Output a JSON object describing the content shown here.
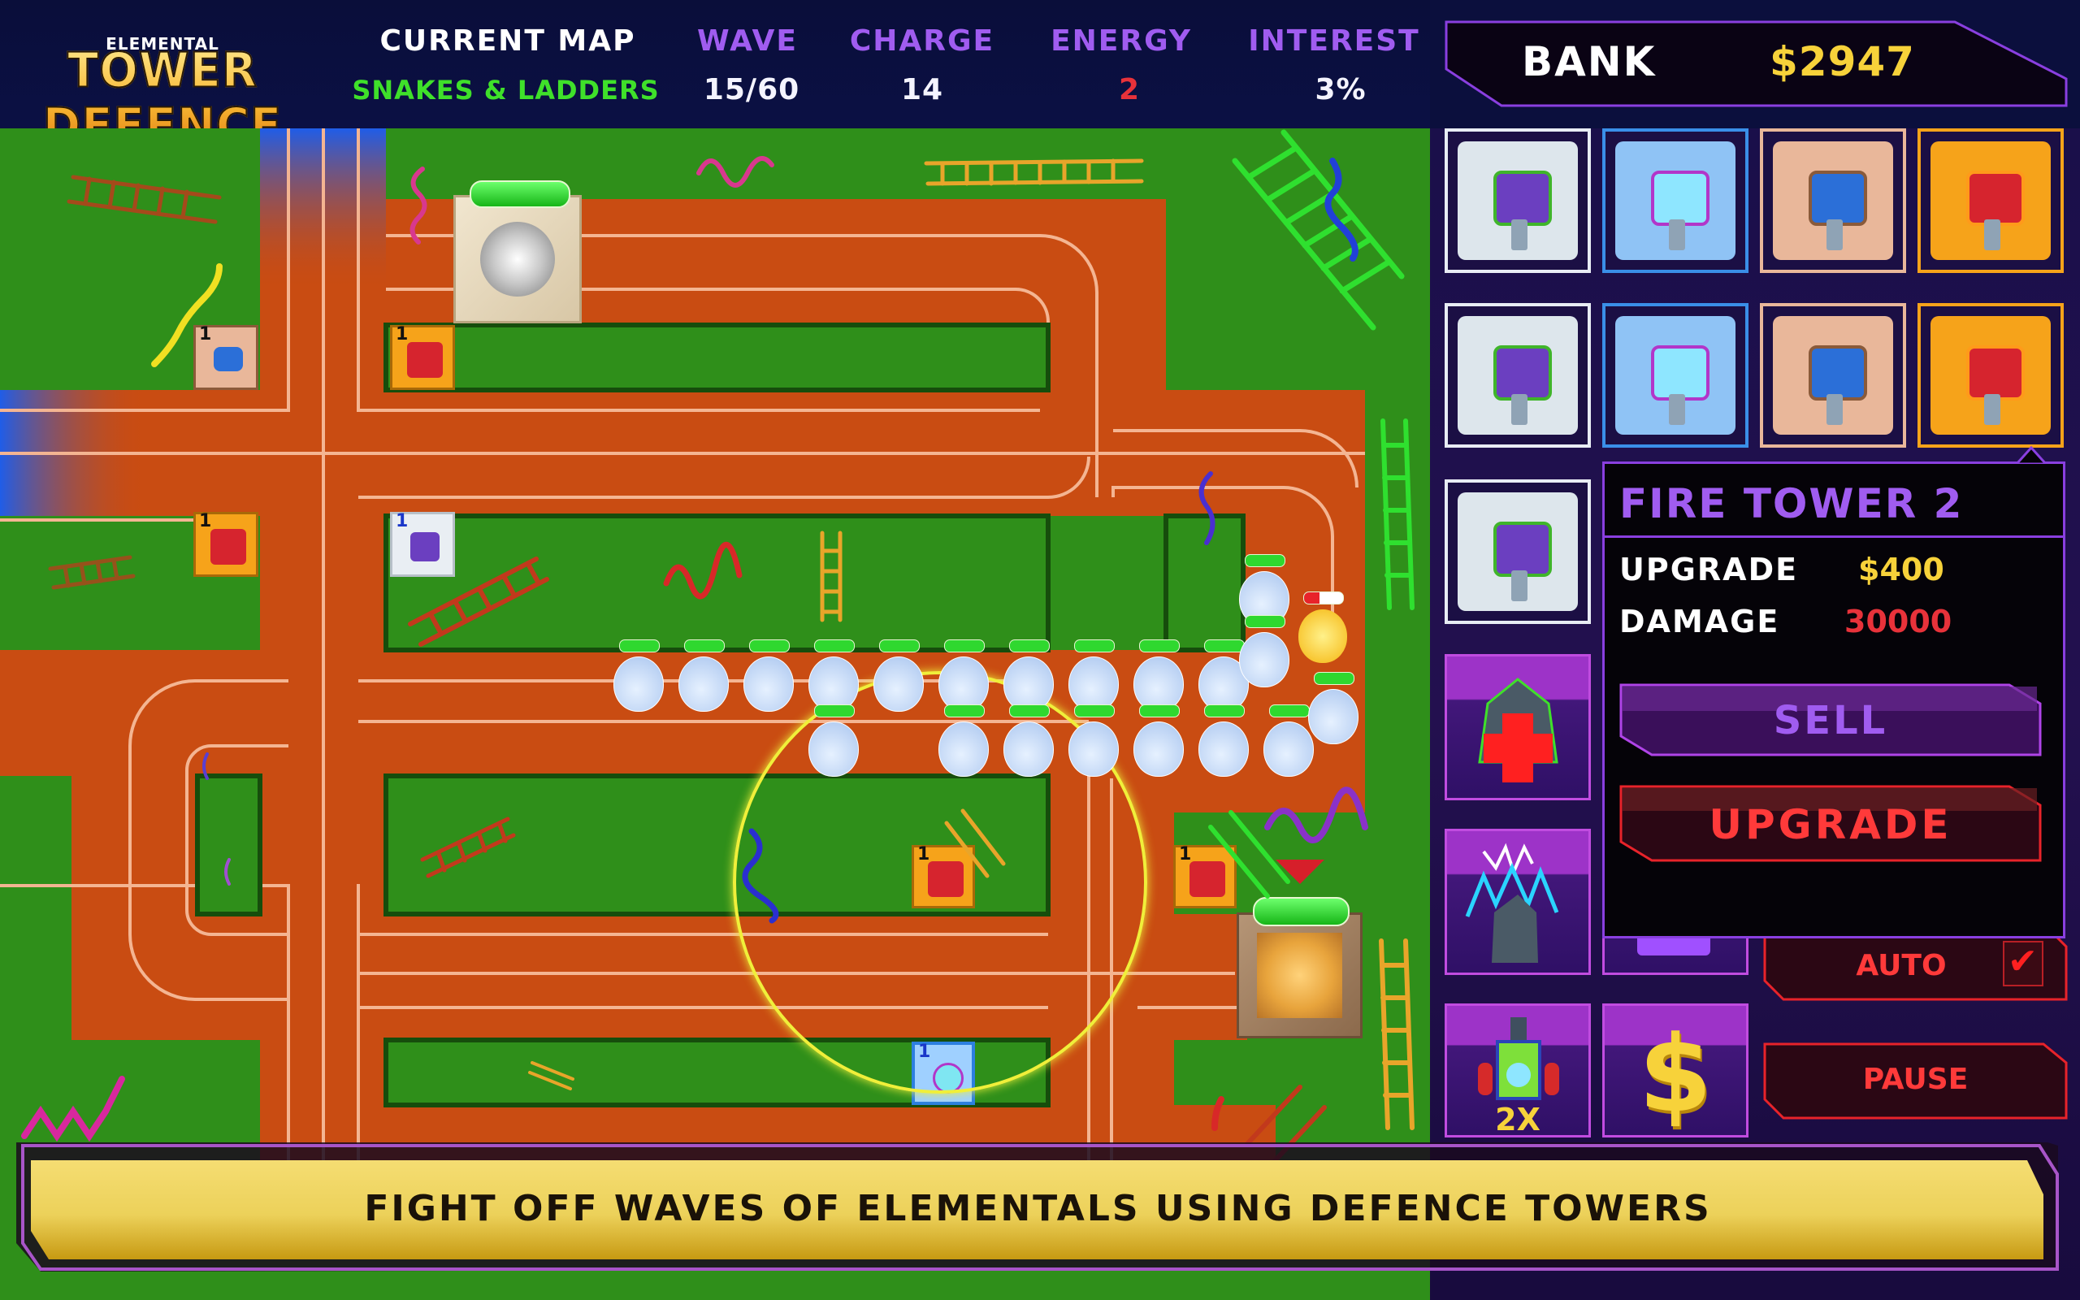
{
  "header": {
    "logo_small": "ELEMENTAL",
    "logo_main": "TOWER DEFENCE",
    "stats": [
      {
        "label": "CURRENT MAP",
        "value": "SNAKES & LADDERS"
      },
      {
        "label": "WAVE",
        "value": "15/60"
      },
      {
        "label": "CHARGE",
        "value": "14"
      },
      {
        "label": "ENERGY",
        "value": "2"
      },
      {
        "label": "INTEREST",
        "value": "3%"
      }
    ]
  },
  "bank": {
    "label": "BANK",
    "value": "$2947"
  },
  "tower_shop": [
    {
      "name": "Wind Tower 1",
      "element": "wind"
    },
    {
      "name": "Water Tower 1",
      "element": "water"
    },
    {
      "name": "Earth Tower 1",
      "element": "earth"
    },
    {
      "name": "Fire Tower 1",
      "element": "fire"
    },
    {
      "name": "Wind Tower 2",
      "element": "wind"
    },
    {
      "name": "Water Tower 2",
      "element": "water"
    },
    {
      "name": "Earth Tower 2",
      "element": "earth"
    },
    {
      "name": "Fire Tower 2",
      "element": "fire"
    },
    {
      "name": "Wind Tower 3",
      "element": "wind"
    }
  ],
  "tooltip": {
    "title": "FIRE TOWER 2",
    "upgrade_label": "UPGRADE",
    "upgrade_cost": "$400",
    "damage_label": "DAMAGE",
    "damage_value": "30000",
    "sell_label": "SELL",
    "upgrade_button": "UPGRADE"
  },
  "powerups": [
    {
      "name": "heal-base",
      "icon": "crystal-plus-icon"
    },
    {
      "name": "lightning-strike",
      "icon": "crystal-lightning-icon"
    },
    {
      "name": "shield",
      "icon": "portal-pad-icon"
    },
    {
      "name": "double-speed",
      "icon": "rocket-icon",
      "label": "2X"
    },
    {
      "name": "bonus-cash",
      "icon": "dollar-icon"
    }
  ],
  "controls": {
    "auto_label": "AUTO",
    "auto_checked": true,
    "pause_label": "PAUSE"
  },
  "banner": {
    "text": "FIGHT OFF WAVES OF ELEMENTALS USING DEFENCE TOWERS"
  },
  "map": {
    "placed_towers": [
      {
        "element": "earth",
        "level": "1"
      },
      {
        "element": "fire",
        "level": "1"
      },
      {
        "element": "fire",
        "level": "1"
      },
      {
        "element": "wind",
        "level": "1"
      },
      {
        "element": "fire",
        "level": "1"
      },
      {
        "element": "fire",
        "level": "1"
      },
      {
        "element": "water",
        "level": "1"
      }
    ],
    "spawn_portal_health": 1.0,
    "base_health": 1.0,
    "enemies_visible": 21,
    "enemy_type": "water elemental"
  },
  "colors": {
    "header_bg": "#0a0e3a",
    "purple": "#a05cf0",
    "green": "#3fe02a",
    "red": "#e8323a",
    "gold": "#f7d23a",
    "track": "#c94c12",
    "grass": "#2f8f1a"
  }
}
